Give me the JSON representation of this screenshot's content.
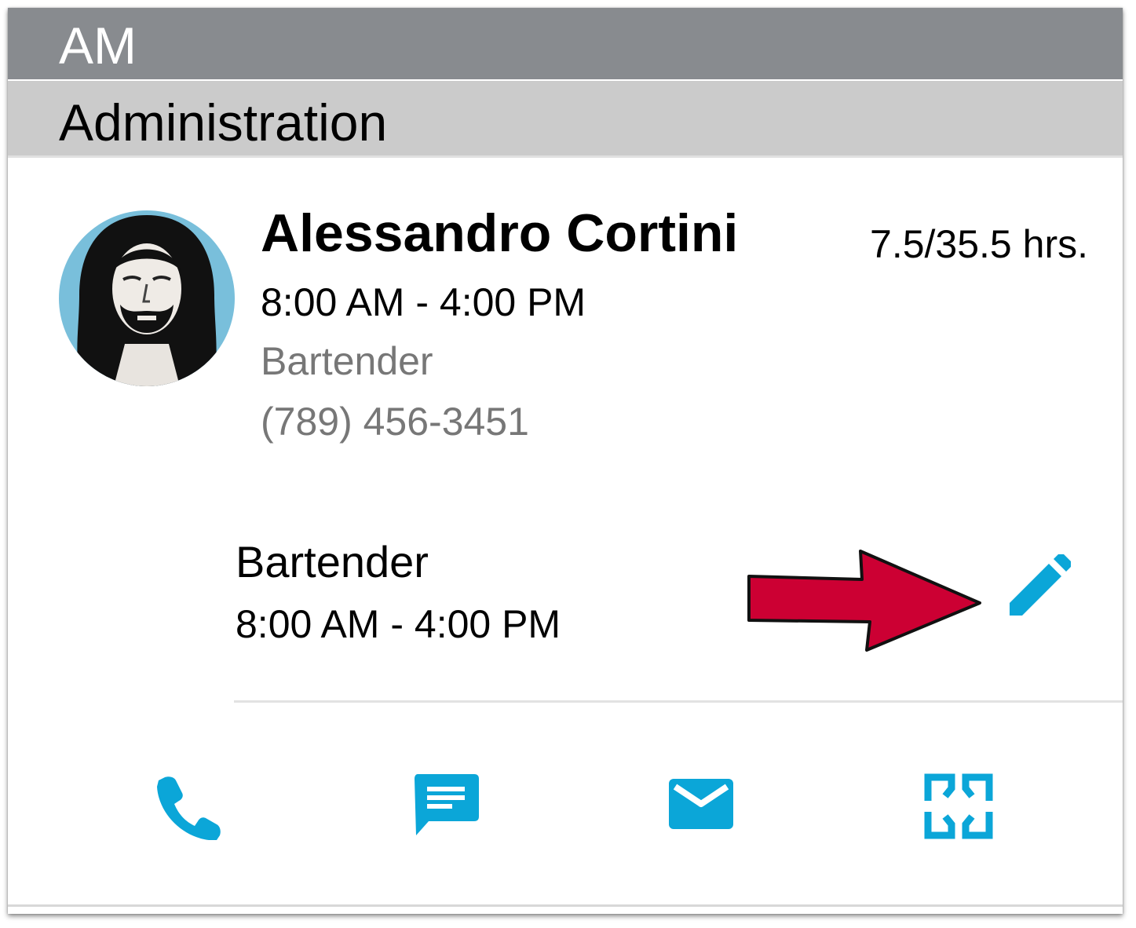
{
  "shift_header": {
    "label": "AM"
  },
  "department": {
    "label": "Administration"
  },
  "employee": {
    "name": "Alessandro Cortini",
    "hours": "7.5/35.5 hrs.",
    "shift_time": "8:00 AM - 4:00 PM",
    "role": "Bartender",
    "phone": "(789) 456-3451"
  },
  "shift_detail": {
    "role": "Bartender",
    "time": "8:00 AM - 4:00 PM"
  },
  "icons": {
    "edit": "pencil-icon",
    "annotation": "red-arrow",
    "actions": [
      "phone-icon",
      "message-icon",
      "email-icon",
      "exchange-icon"
    ]
  },
  "colors": {
    "accent": "#0ba6d8",
    "shift_header_bg": "#888b8f",
    "department_bg": "#cbcbcb",
    "annotation_arrow": "#cc0033",
    "secondary_text": "#777777"
  }
}
